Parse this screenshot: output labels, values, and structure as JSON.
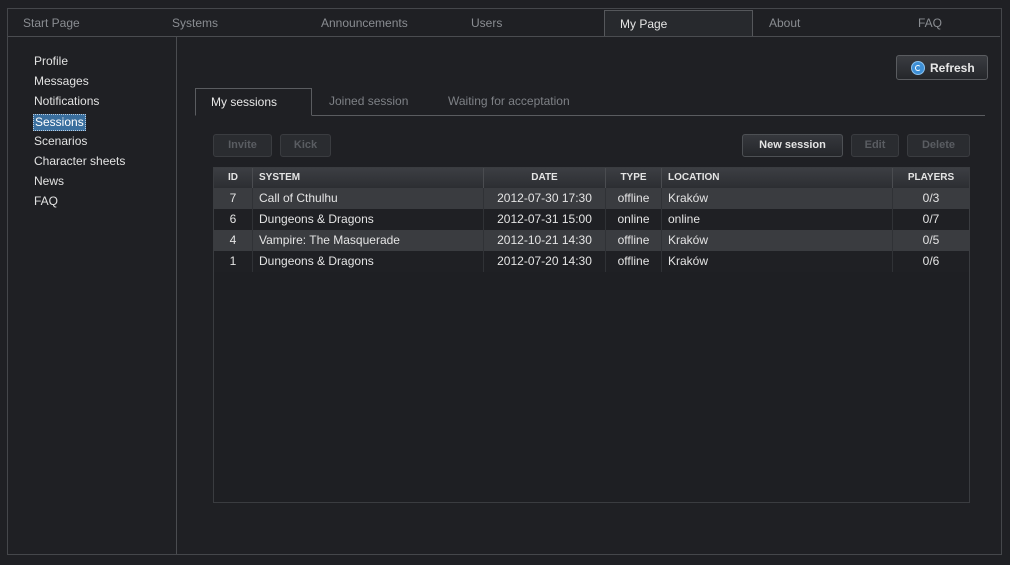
{
  "topnav": {
    "items": [
      "Start Page",
      "Systems",
      "Announcements",
      "Users",
      "My Page",
      "About",
      "FAQ"
    ],
    "active": "My Page"
  },
  "sidebar": {
    "items": [
      "Profile",
      "Messages",
      "Notifications",
      "Sessions",
      "Scenarios",
      "Character sheets",
      "News",
      "FAQ"
    ],
    "selected": "Sessions"
  },
  "toolbar": {
    "refresh_label": "Refresh",
    "invite_label": "Invite",
    "kick_label": "Kick",
    "new_session_label": "New session",
    "edit_label": "Edit",
    "delete_label": "Delete"
  },
  "subtabs": {
    "items": [
      "My sessions",
      "Joined session",
      "Waiting for acceptation"
    ],
    "active": "My sessions"
  },
  "table": {
    "columns": [
      "ID",
      "SYSTEM",
      "DATE",
      "TYPE",
      "LOCATION",
      "PLAYERS"
    ],
    "rows": [
      {
        "id": "7",
        "system": "Call of Cthulhu",
        "date": "2012-07-30 17:30",
        "type": "offline",
        "location": "Kraków",
        "players": "0/3"
      },
      {
        "id": "6",
        "system": "Dungeons & Dragons",
        "date": "2012-07-31 15:00",
        "type": "online",
        "location": "online",
        "players": "0/7"
      },
      {
        "id": "4",
        "system": "Vampire: The Masquerade",
        "date": "2012-10-21 14:30",
        "type": "offline",
        "location": "Kraków",
        "players": "0/5"
      },
      {
        "id": "1",
        "system": "Dungeons & Dragons",
        "date": "2012-07-20 14:30",
        "type": "offline",
        "location": "Kraków",
        "players": "0/6"
      }
    ]
  },
  "colors": {
    "background": "#1f2024",
    "selection": "#3a6f9e",
    "refresh_icon": "#3d8fd6"
  },
  "icons": {
    "refresh": "refresh-icon"
  }
}
